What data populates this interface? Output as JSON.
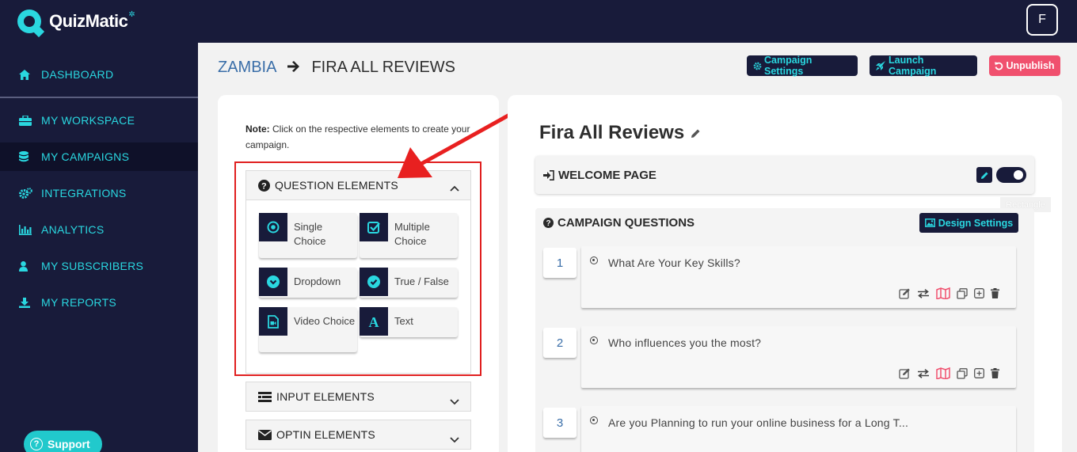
{
  "app": {
    "name": "QuizMatic",
    "user_initial": "F"
  },
  "sidebar": {
    "items": [
      {
        "label": "DASHBOARD",
        "icon": "home-icon"
      },
      {
        "label": "MY WORKSPACE",
        "icon": "briefcase-icon"
      },
      {
        "label": "MY CAMPAIGNS",
        "icon": "database-icon",
        "active": true
      },
      {
        "label": "INTEGRATIONS",
        "icon": "cogs-icon"
      },
      {
        "label": "ANALYTICS",
        "icon": "bar-chart-icon"
      },
      {
        "label": "MY SUBSCRIBERS",
        "icon": "user-icon"
      },
      {
        "label": "MY REPORTS",
        "icon": "download-icon"
      }
    ],
    "support_label": "Support"
  },
  "breadcrumb": {
    "workspace": "ZAMBIA",
    "current": "FIRA ALL REVIEWS"
  },
  "toolbar": {
    "campaign_settings": "Campaign Settings",
    "launch_campaign": "Launch Campaign",
    "unpublish": "Unpublish"
  },
  "builder": {
    "note_label": "Note:",
    "note_text": " Click on the respective elements to create your campaign.",
    "question_elements": "QUESTION ELEMENTS",
    "input_elements": "INPUT ELEMENTS",
    "optin_elements": "OPTIN ELEMENTS",
    "elements": [
      {
        "label": "Single Choice",
        "icon": "radio-icon"
      },
      {
        "label": "Multiple Choice",
        "icon": "checkbox-icon"
      },
      {
        "label": "Dropdown",
        "icon": "dropdown-icon"
      },
      {
        "label": "True / False",
        "icon": "check-circle-icon"
      },
      {
        "label": "Video Choice",
        "icon": "video-file-icon"
      },
      {
        "label": "Text",
        "icon": "text-icon"
      }
    ]
  },
  "campaign": {
    "title": "Fira All Reviews",
    "welcome_page": "WELCOME PAGE",
    "tooltip": "Rectangle",
    "questions_header": "CAMPAIGN QUESTIONS",
    "design_settings": "Design Settings",
    "questions": [
      {
        "number": "1",
        "text": "What Are Your Key Skills?"
      },
      {
        "number": "2",
        "text": "Who influences you the most?"
      },
      {
        "number": "3",
        "text": "Are you Planning to run your online business for a Long T..."
      }
    ]
  },
  "colors": {
    "navy": "#181b3a",
    "cyan": "#2ad7e0",
    "red": "#f0506e",
    "highlight": "#e01f1f"
  }
}
